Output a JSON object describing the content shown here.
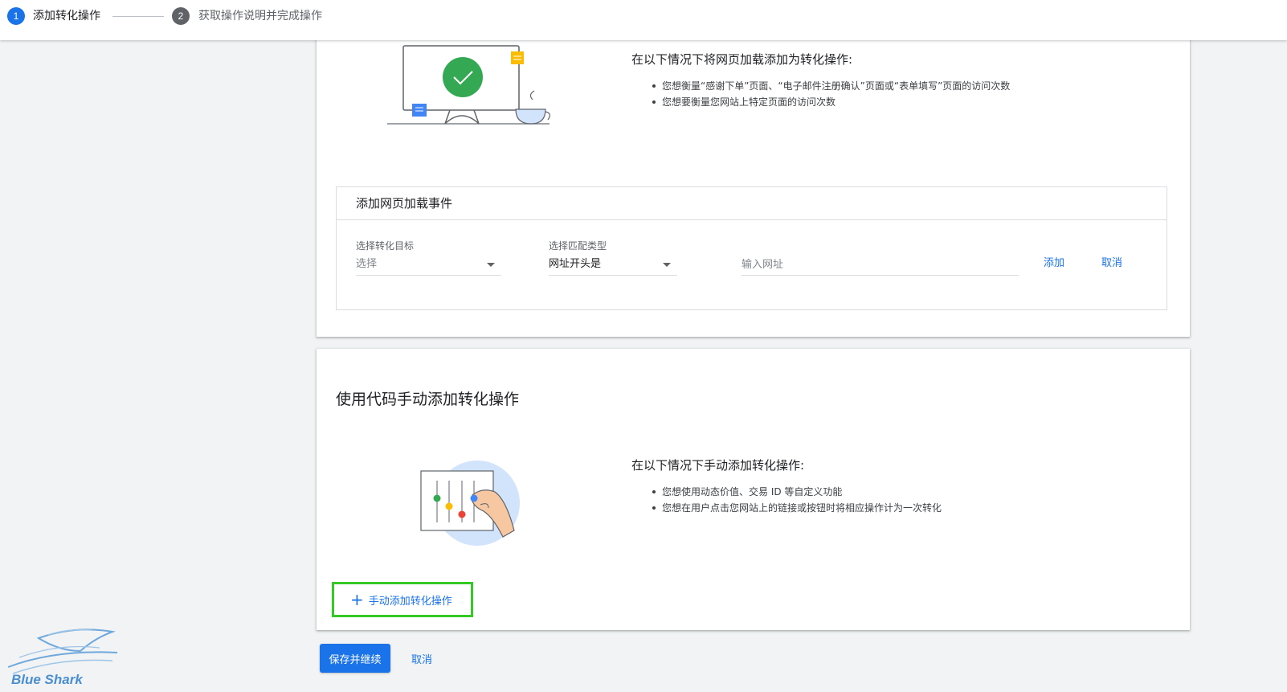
{
  "stepper": {
    "steps": [
      {
        "number": "1",
        "label": "添加转化操作",
        "state": "active"
      },
      {
        "number": "2",
        "label": "获取操作说明并完成操作",
        "state": "inactive"
      }
    ]
  },
  "page_load_card": {
    "illustration": "monitor-checkmark-icon",
    "info_title": "在以下情况下将网页加载添加为转化操作:",
    "info_items": [
      "您想衡量“感谢下单”页面、“电子邮件注册确认”页面或“表单填写”页面的访问次数",
      "您想要衡量您网站上特定页面的访问次数"
    ],
    "form": {
      "title": "添加网页加载事件",
      "goal_label": "选择转化目标",
      "goal_value": "选择",
      "match_label": "选择匹配类型",
      "match_value": "网址开头是",
      "url_placeholder": "输入网址",
      "add_label": "添加",
      "cancel_label": "取消"
    }
  },
  "manual_card": {
    "title": "使用代码手动添加转化操作",
    "illustration": "sliders-hand-icon",
    "info_title": "在以下情况下手动添加转化操作:",
    "info_items": [
      "您想使用动态价值、交易 ID 等自定义功能",
      "您想在用户点击您网站上的链接或按钮时将相应操作计为一次转化"
    ],
    "button_label": "手动添加转化操作"
  },
  "footer": {
    "save_label": "保存并继续",
    "cancel_label": "取消"
  },
  "watermark": {
    "text": "Blue Shark"
  },
  "colors": {
    "primary": "#1a73e8",
    "highlight_border": "#34c924",
    "background": "#f1f3f4"
  }
}
